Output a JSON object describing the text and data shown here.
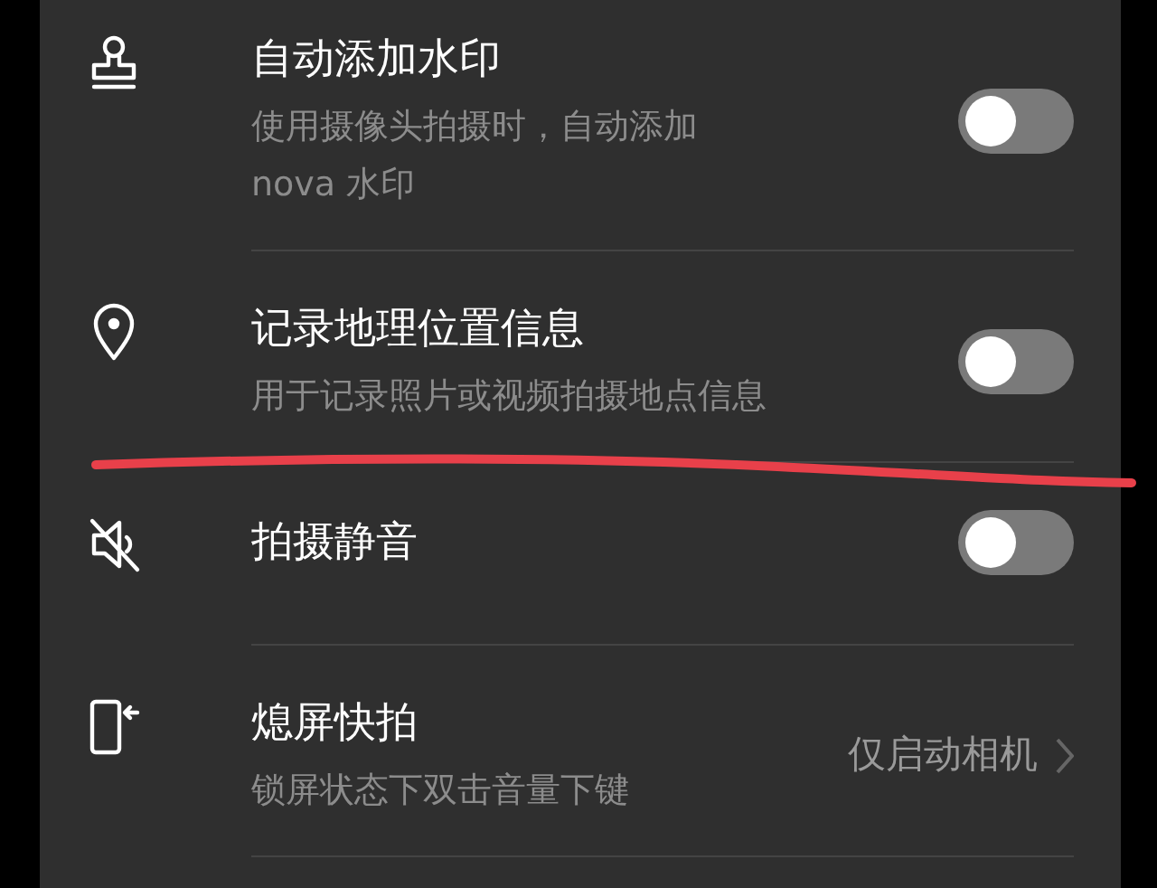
{
  "settings": [
    {
      "kind": "toggle",
      "title": "自动添加水印",
      "subtitle": "使用摄像头拍摄时，自动添加nova 水印",
      "on": false
    },
    {
      "kind": "toggle",
      "title": "记录地理位置信息",
      "subtitle": "用于记录照片或视频拍摄地点信息",
      "on": false
    },
    {
      "kind": "toggle",
      "title": "拍摄静音",
      "on": false
    },
    {
      "kind": "link",
      "title": "熄屏快拍",
      "subtitle": "锁屏状态下双击音量下键",
      "value": "仅启动相机"
    }
  ]
}
